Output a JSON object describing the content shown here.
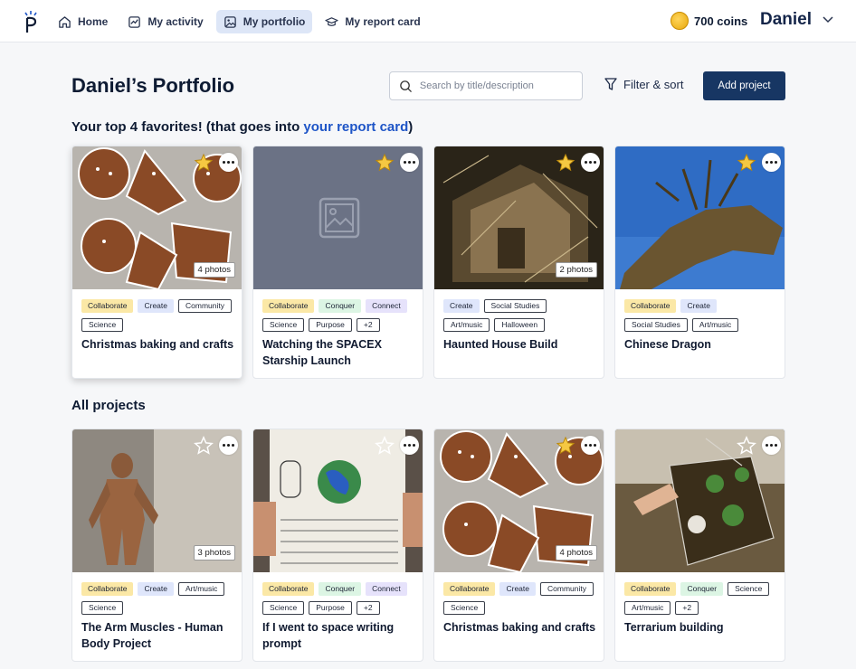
{
  "nav": {
    "items": [
      {
        "label": "Home",
        "icon": "home-icon"
      },
      {
        "label": "My activity",
        "icon": "activity-icon"
      },
      {
        "label": "My portfolio",
        "icon": "portfolio-icon",
        "active": true
      },
      {
        "label": "My report card",
        "icon": "graduation-cap-icon"
      }
    ],
    "coins": "700 coins",
    "user": "Daniel"
  },
  "header": {
    "title": "Daniel’s Portfolio",
    "search_placeholder": "Search by title/description",
    "filter_label": "Filter & sort",
    "add_label": "Add project"
  },
  "favorites": {
    "title_prefix": "Your top 4 favorites! (that goes into ",
    "title_link": "your report card",
    "title_suffix": ")",
    "cards": [
      {
        "title": "Christmas baking and crafts",
        "photos": "4 photos",
        "starred": true,
        "tags": [
          [
            "Collaborate",
            "collab"
          ],
          [
            "Create",
            "create"
          ],
          [
            "Community",
            "out"
          ],
          [
            "Science",
            "out"
          ]
        ]
      },
      {
        "title": "Watching the SPACEX Starship Launch",
        "photos": "",
        "starred": true,
        "tags": [
          [
            "Collaborate",
            "collab"
          ],
          [
            "Conquer",
            "conquer"
          ],
          [
            "Connect",
            "connect"
          ],
          [
            "Science",
            "out"
          ],
          [
            "Purpose",
            "out"
          ],
          [
            "+2",
            "out"
          ]
        ]
      },
      {
        "title": "Haunted House Build",
        "photos": "2 photos",
        "starred": true,
        "tags": [
          [
            "Create",
            "create"
          ],
          [
            "Social Studies",
            "out"
          ],
          [
            "Art/music",
            "out"
          ],
          [
            "Halloween",
            "out"
          ]
        ]
      },
      {
        "title": "Chinese Dragon",
        "photos": "",
        "starred": true,
        "tags": [
          [
            "Collaborate",
            "collab"
          ],
          [
            "Create",
            "create"
          ],
          [
            "Social Studies",
            "out"
          ],
          [
            "Art/music",
            "out"
          ]
        ]
      }
    ]
  },
  "all_projects": {
    "title": "All projects",
    "cards": [
      {
        "title": "The Arm Muscles - Human Body Project",
        "photos": "3 photos",
        "starred": false,
        "tags": [
          [
            "Collaborate",
            "collab"
          ],
          [
            "Create",
            "create"
          ],
          [
            "Art/music",
            "out"
          ],
          [
            "Science",
            "out"
          ]
        ]
      },
      {
        "title": "If I went to space writing prompt",
        "photos": "",
        "starred": false,
        "tags": [
          [
            "Collaborate",
            "collab"
          ],
          [
            "Conquer",
            "conquer"
          ],
          [
            "Connect",
            "connect"
          ],
          [
            "Science",
            "out"
          ],
          [
            "Purpose",
            "out"
          ],
          [
            "+2",
            "out"
          ]
        ]
      },
      {
        "title": "Christmas baking and crafts",
        "photos": "4 photos",
        "starred": true,
        "tags": [
          [
            "Collaborate",
            "collab"
          ],
          [
            "Create",
            "create"
          ],
          [
            "Community",
            "out"
          ],
          [
            "Science",
            "out"
          ]
        ]
      },
      {
        "title": "Terrarium building",
        "photos": "",
        "starred": false,
        "tags": [
          [
            "Collaborate",
            "collab"
          ],
          [
            "Conquer",
            "conquer"
          ],
          [
            "Science",
            "out"
          ],
          [
            "Art/music",
            "out"
          ],
          [
            "+2",
            "out"
          ]
        ]
      }
    ]
  },
  "colors": {
    "accent": "#173663",
    "link": "#1e55c7",
    "active_nav": "#dde6f7"
  }
}
